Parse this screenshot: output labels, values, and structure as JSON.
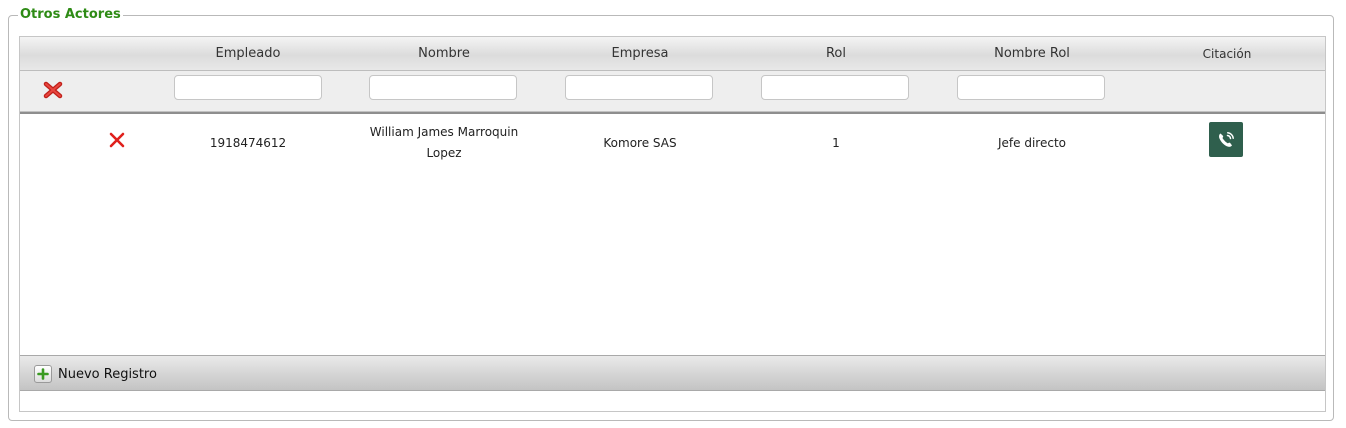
{
  "section": {
    "title": "Otros Actores"
  },
  "columns": {
    "empleado": "Empleado",
    "nombre": "Nombre",
    "empresa": "Empresa",
    "rol": "Rol",
    "nombre_rol": "Nombre Rol",
    "citacion": "Citación"
  },
  "filters": {
    "empleado": "",
    "nombre": "",
    "empresa": "",
    "rol": "",
    "nombre_rol": ""
  },
  "rows": [
    {
      "empleado": "1918474612",
      "nombre": "William James Marroquin Lopez",
      "empresa": "Komore SAS",
      "rol": "1",
      "nombre_rol": "Jefe directo"
    }
  ],
  "footer": {
    "add_label": "Nuevo Registro"
  },
  "icons": {
    "clear_filter": "close-icon",
    "delete_row": "close-icon",
    "citacion": "phone-icon",
    "add": "plus-icon"
  },
  "colors": {
    "title_green": "#2e8b15",
    "delete_red": "#e0201c",
    "call_button": "#2f5f4d",
    "add_green": "#3a9a22"
  }
}
